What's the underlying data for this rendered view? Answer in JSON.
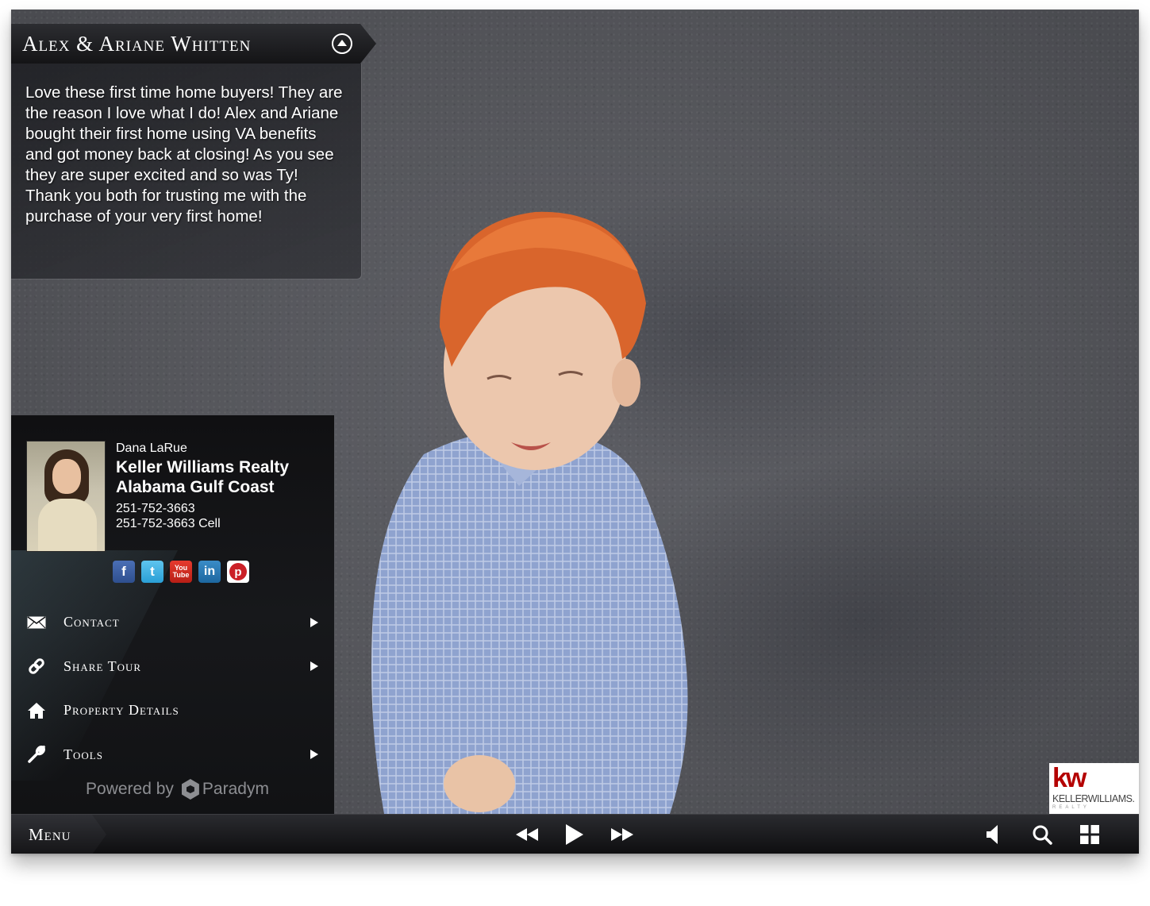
{
  "header": {
    "title": "Alex & Ariane Whitten"
  },
  "description": "Love these first time home buyers! They are the reason I love what I do! Alex and Ariane bought their first home using VA benefits and got money back at closing! As you see they are super excited and so was Ty! Thank you both for trusting me with the purchase of your very first home!",
  "agent": {
    "name": "Dana LaRue",
    "company_line1": "Keller Williams Realty",
    "company_line2": "Alabama Gulf Coast",
    "phone": "251-752-3663",
    "cell": "251-752-3663 Cell"
  },
  "social": [
    {
      "label": "f",
      "icon": "facebook-icon"
    },
    {
      "label": "t",
      "icon": "twitter-icon"
    },
    {
      "label_top": "You",
      "label_bottom": "Tube",
      "icon": "youtube-icon"
    },
    {
      "label": "in",
      "icon": "linkedin-icon"
    },
    {
      "label": "p",
      "icon": "pinterest-icon"
    }
  ],
  "menu": {
    "items": [
      {
        "label": "Contact",
        "icon": "envelope-icon",
        "has_submenu": true
      },
      {
        "label": "Share Tour",
        "icon": "link-icon",
        "has_submenu": true
      },
      {
        "label": "Property Details",
        "icon": "home-icon",
        "has_submenu": false
      },
      {
        "label": "Tools",
        "icon": "wrench-icon",
        "has_submenu": true
      }
    ]
  },
  "powered_by": {
    "prefix": "Powered by",
    "brand": "Paradym"
  },
  "logo": {
    "mark": "kw",
    "name": "KELLERWILLIAMS.",
    "sub": "REALTY"
  },
  "toolbar": {
    "menu_label": "Menu"
  },
  "colors": {
    "kw_red": "#b40101",
    "panel_dark": "#101012",
    "text": "#ffffff"
  }
}
